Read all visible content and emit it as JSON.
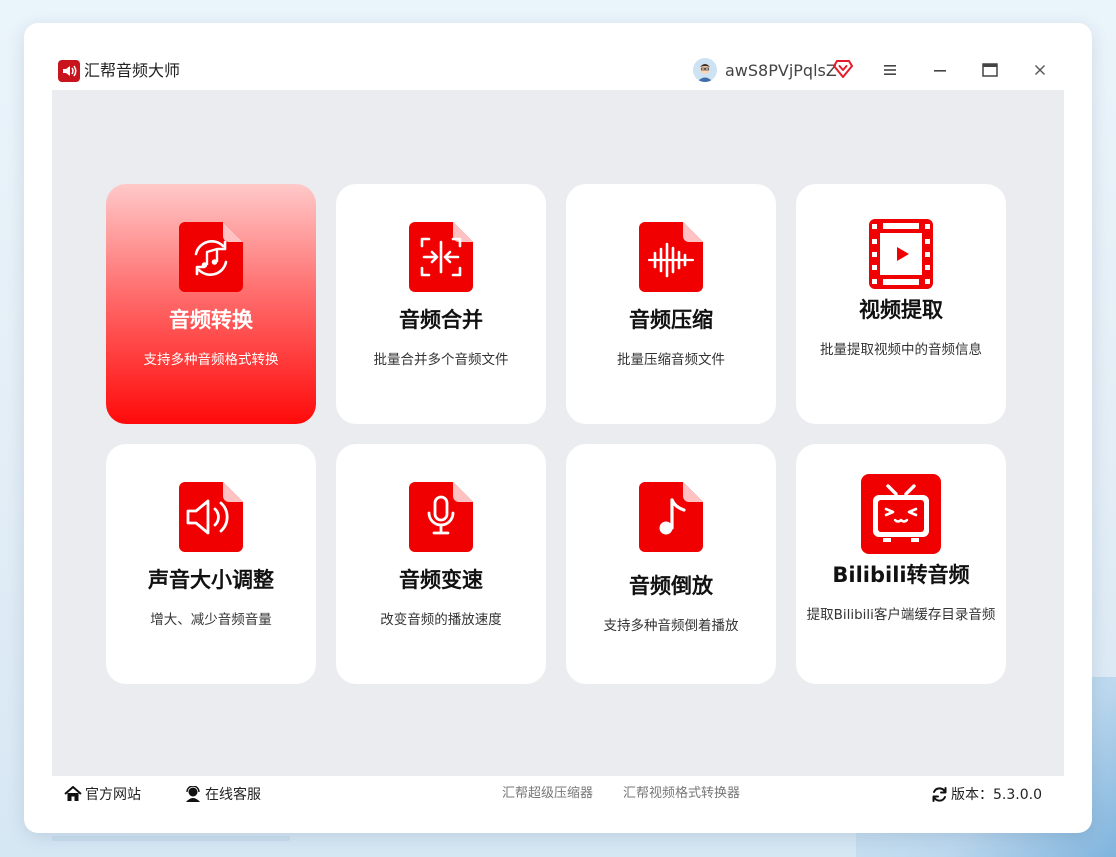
{
  "app": {
    "title": "汇帮音频大师"
  },
  "user": {
    "name": "awS8PVjPqlsZ"
  },
  "colors": {
    "brand_red": "#f00000",
    "active_card_top": "#ffc9c9",
    "active_card_bottom": "#ff0a0a",
    "content_bg": "#ebecf0"
  },
  "cards": [
    {
      "title": "音频转换",
      "desc": "支持多种音频格式转换",
      "icon": "audio-convert-icon",
      "active": true
    },
    {
      "title": "音频合并",
      "desc": "批量合并多个音频文件",
      "icon": "audio-merge-icon",
      "active": false
    },
    {
      "title": "音频压缩",
      "desc": "批量压缩音频文件",
      "icon": "audio-compress-icon",
      "active": false
    },
    {
      "title": "视频提取",
      "desc": "批量提取视频中的音频信息",
      "icon": "video-extract-icon",
      "active": false
    },
    {
      "title": "声音大小调整",
      "desc": "增大、减少音频音量",
      "icon": "volume-adjust-icon",
      "active": false
    },
    {
      "title": "音频变速",
      "desc": "改变音频的播放速度",
      "icon": "audio-speed-icon",
      "active": false
    },
    {
      "title": "音频倒放",
      "desc": "支持多种音频倒着播放",
      "icon": "audio-reverse-icon",
      "active": false
    },
    {
      "title": "Bilibili转音频",
      "desc": "提取Bilibili客户端缓存目录音频",
      "icon": "bilibili-tv-icon",
      "active": false
    }
  ],
  "footer": {
    "website": "官方网站",
    "support": "在线客服",
    "link1": "汇帮超级压缩器",
    "link2": "汇帮视频格式转换器",
    "version": "版本：5.3.0.0"
  }
}
